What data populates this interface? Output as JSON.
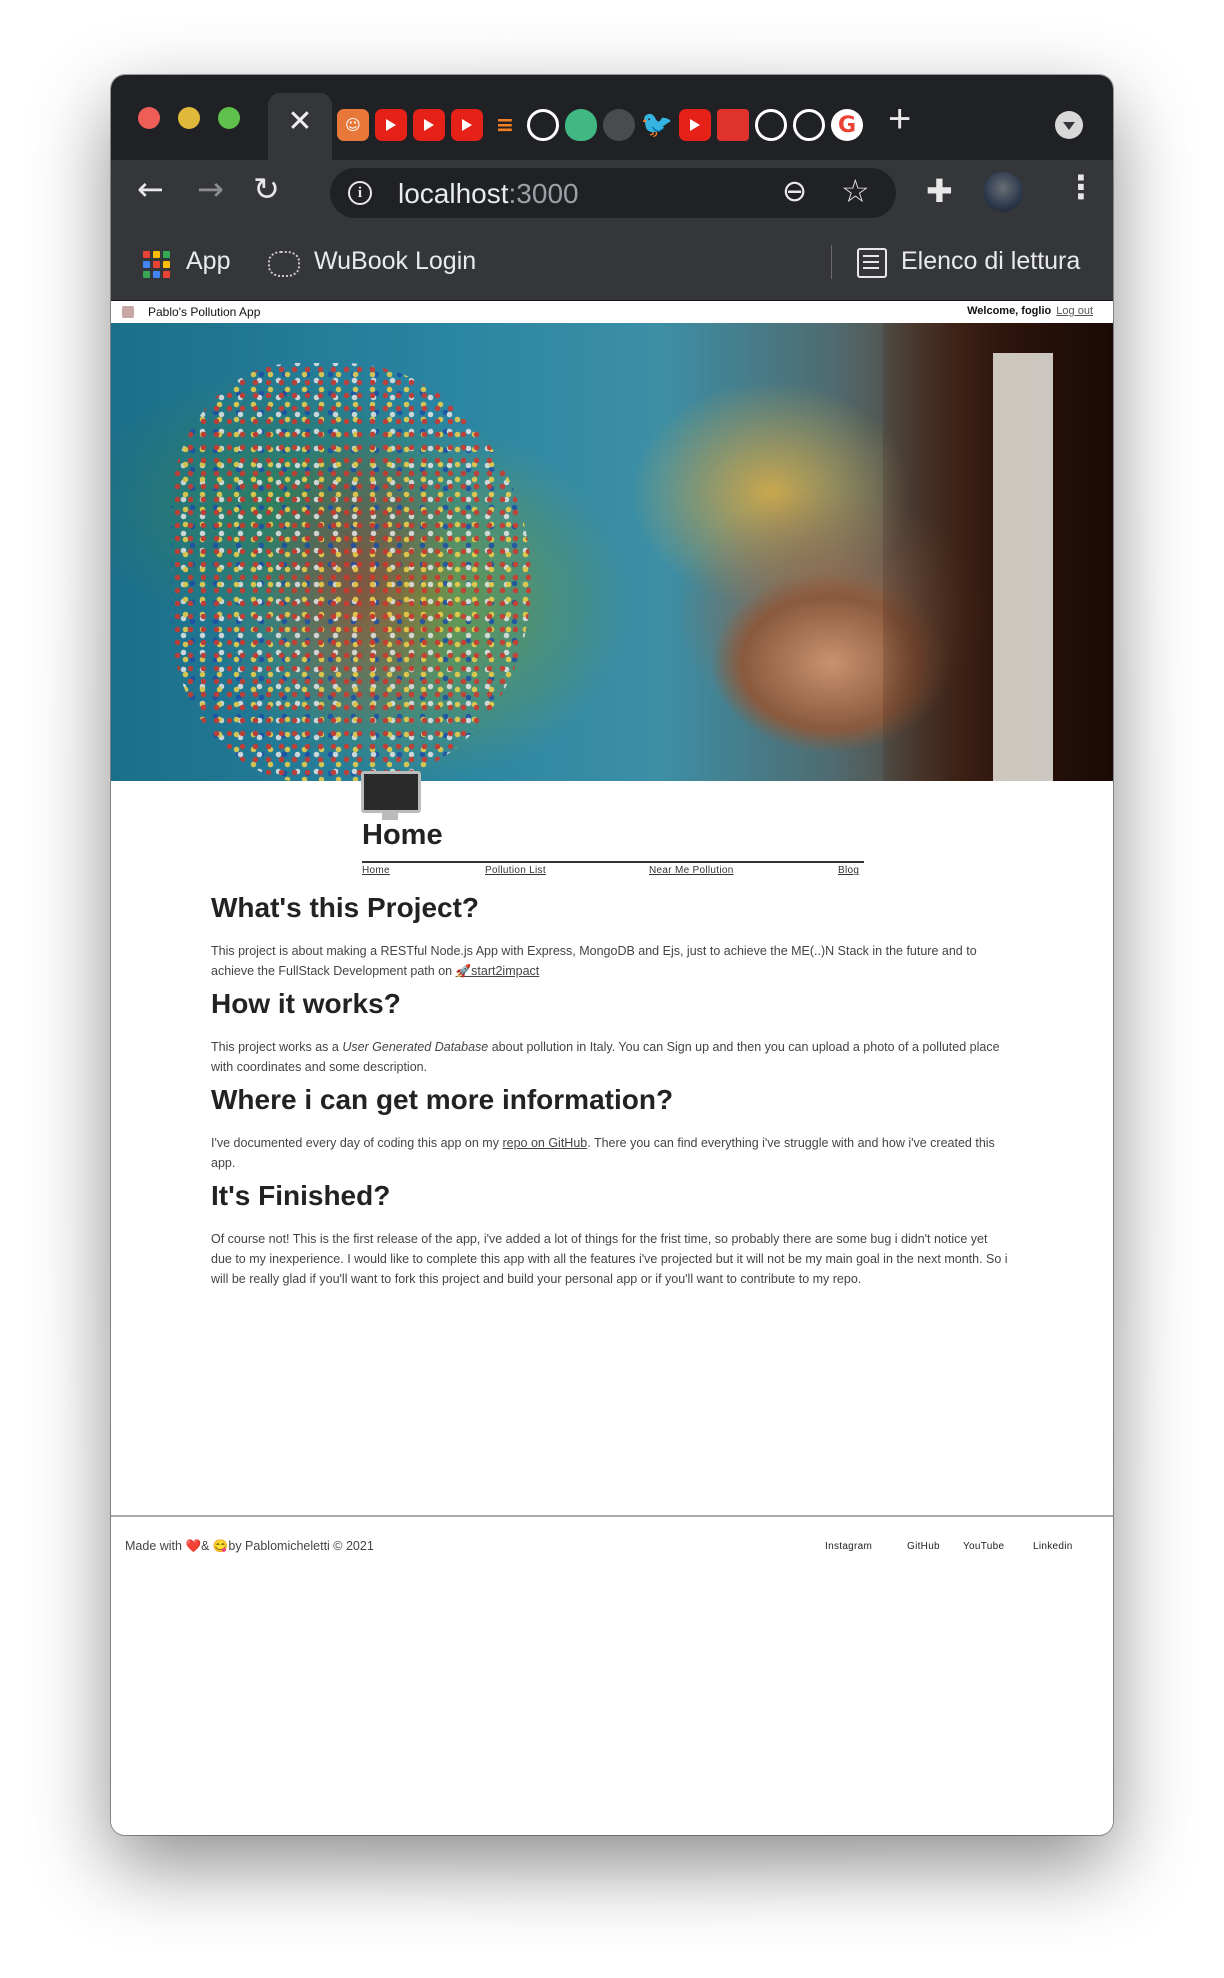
{
  "browser": {
    "url_host": "localhost",
    "url_port": ":3000",
    "bookmarks": {
      "apps_label": "App",
      "wubook_label": "WuBook Login",
      "reading_list_label": "Elenco di lettura"
    },
    "icons": {
      "back": "←",
      "forward": "→",
      "reload": "↻",
      "zoom": "⊖",
      "star": "☆",
      "extensions": "✚",
      "menu": "⋮",
      "close_tab": "✕",
      "new_tab": "+",
      "info": "i"
    }
  },
  "site": {
    "title": "Pablo's Pollution App",
    "welcome_prefix": "Welcome, foglio",
    "logout_label": "Log out"
  },
  "home": {
    "heading": "Home",
    "nav": {
      "home": "Home",
      "pollution_list": "Pollution List",
      "near_me": "Near Me Pollution",
      "blog": "Blog"
    }
  },
  "sections": {
    "s1_title": "What's this Project?",
    "s1_text": "This project is about making a RESTful Node.js App with Express, MongoDB and Ejs, just to achieve the ME(..)N Stack in the future and to achieve the FullStack Development path on",
    "s1_link": "🚀start2impact",
    "s2_title": "How it works?",
    "s2_text_a": "This project works as a",
    "s2_em": "User Generated Database",
    "s2_text_b": "about pollution in Italy. You can Sign up and then you can upload a photo of a polluted place with coordinates and some description.",
    "s3_title": "Where i can get more information?",
    "s3_text_a": "I've documented every day of coding this app on my",
    "s3_link": "repo on GitHub",
    "s3_text_b": ". There you can find everything i've struggle with and how i've created this app.",
    "s4_title": "It's Finished?",
    "s4_text": "Of course not! This is the first release of the app, i've added a lot of things for the frist time, so probably there are some bug i didn't notice yet due to my inexperience. I would like to complete this app with all the features i've projected but it will not be my main goal in the next month. So i will be really glad if you'll want to fork this project and build your personal app or if you'll want to contribute to my repo."
  },
  "footer": {
    "made_with": "Made with ❤️& 😋by Pablomicheletti © 2021",
    "links": [
      "Instagram",
      "GitHub",
      "YouTube",
      "Linkedin"
    ]
  }
}
